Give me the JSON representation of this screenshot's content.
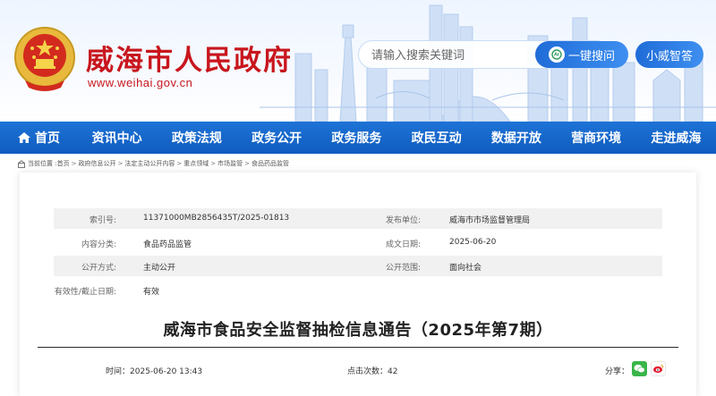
{
  "site": {
    "title": "威海市人民政府",
    "url": "www.weihai.gov.cn"
  },
  "search": {
    "placeholder": "请输入搜索关键词",
    "ai_button_label": "一键搜问",
    "assistant_label": "小威智答"
  },
  "nav": {
    "items": [
      {
        "label": "首页"
      },
      {
        "label": "资讯中心"
      },
      {
        "label": "政策法规"
      },
      {
        "label": "政务公开"
      },
      {
        "label": "政务服务"
      },
      {
        "label": "政民互动"
      },
      {
        "label": "数据开放"
      },
      {
        "label": "营商环境"
      },
      {
        "label": "走进威海"
      }
    ]
  },
  "breadcrumb": {
    "prefix": "当前位置 : ",
    "items": [
      "首页",
      "政府信息公开",
      "法定主动公开内容",
      "重点领域",
      "市场监管",
      "食品药品监管"
    ],
    "separator": ">"
  },
  "meta": {
    "index_label": "索引号:",
    "index_value": "11371000MB2856435T/2025-01813",
    "publisher_label": "发布单位:",
    "publisher_value": "威海市市场监督管理局",
    "category_label": "内容分类:",
    "category_value": "食品药品监管",
    "created_label": "成文日期:",
    "created_value": "2025-06-20",
    "method_label": "公开方式:",
    "method_value": "主动公开",
    "scope_label": "公开范围:",
    "scope_value": "面向社会",
    "validity_label": "有效性/截止日期:",
    "validity_value": "有效"
  },
  "article": {
    "title": "威海市食品安全监督抽检信息通告（2025年第7期）",
    "time_label": "时间：",
    "time_value": "2025-06-20 13:43",
    "clicks_label": "点击次数：",
    "clicks_value": "42",
    "share_label": "分享："
  },
  "colors": {
    "brand_red": "#c8161d",
    "nav_blue": "#1565c8",
    "wechat_green": "#3ab54a",
    "weibo_red": "#e6162d"
  }
}
